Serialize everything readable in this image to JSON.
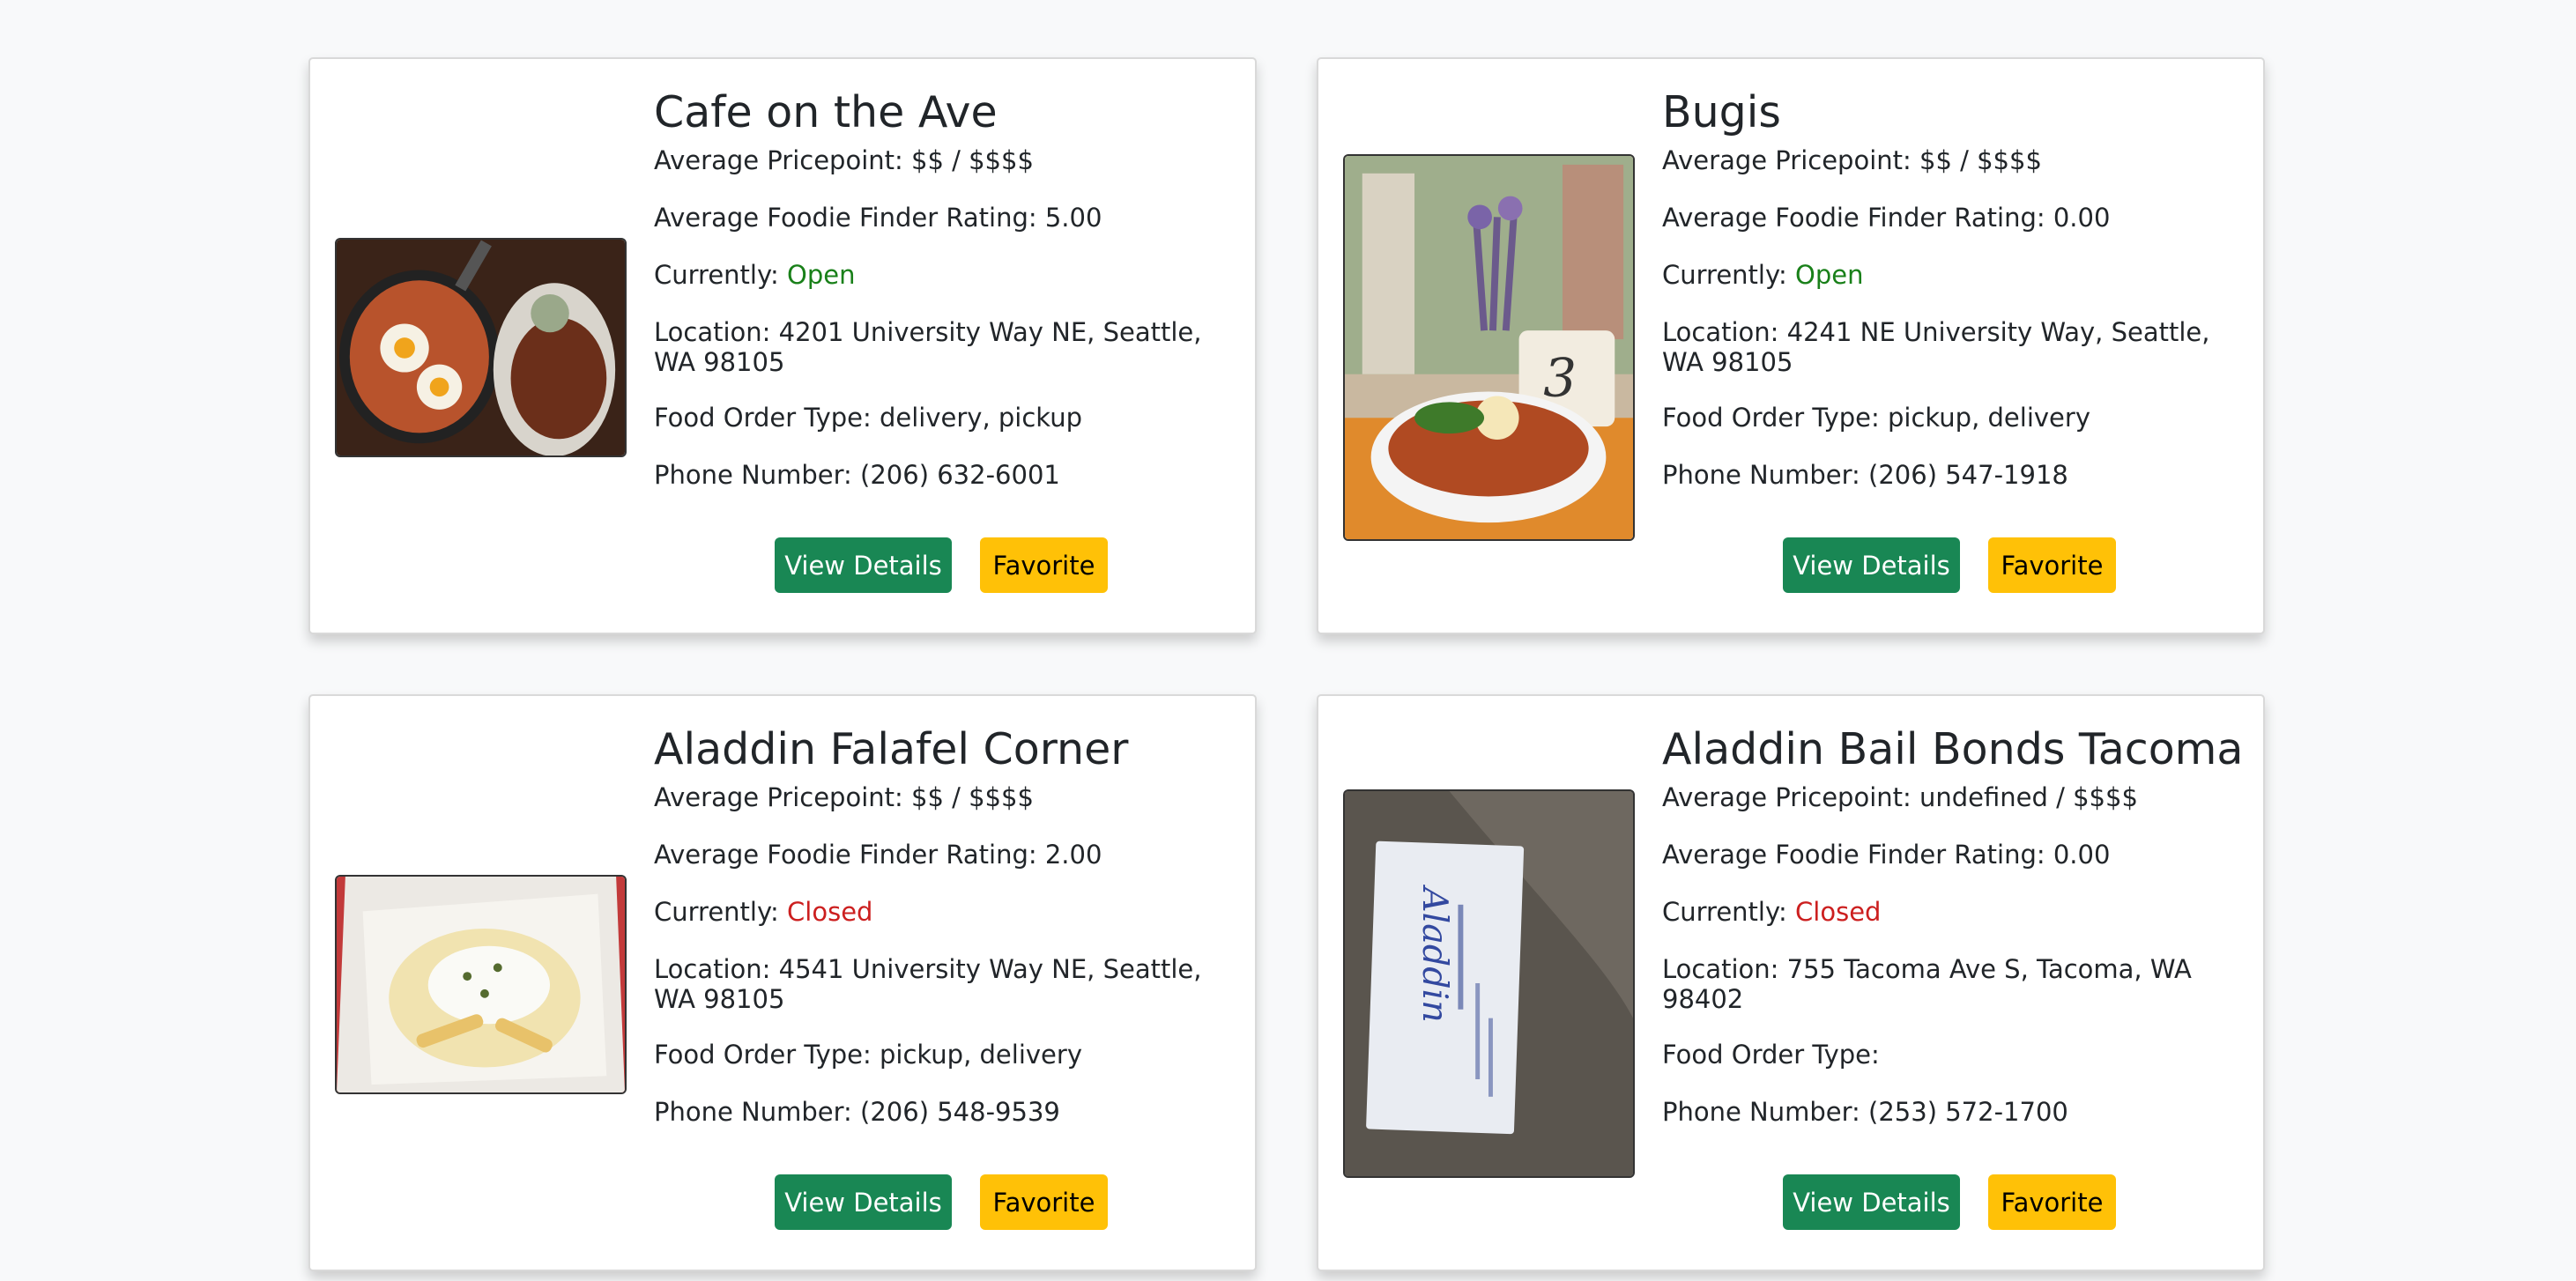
{
  "colors": {
    "page_bg": "#f8f9fa",
    "open": "#198019",
    "closed": "#cc1f1f",
    "details_button": "#198754",
    "favorite_button": "#ffc107"
  },
  "restaurants": [
    {
      "name": "Cafe on the Ave",
      "price": "Average Pricepoint: $$ / $$$$",
      "rating": "Average Foodie Finder Rating: 5.00",
      "status_label": "Currently: ",
      "status": "Open",
      "location": "Location: 4201 University Way NE, Seattle, WA 98105",
      "order_type": "Food Order Type: delivery, pickup",
      "phone": "Phone Number: (206) 632-6001",
      "details_label": "View Details",
      "favorite_label": "Favorite"
    },
    {
      "name": "Bugis",
      "price": "Average Pricepoint: $$ / $$$$",
      "rating": "Average Foodie Finder Rating: 0.00",
      "status_label": "Currently: ",
      "status": "Open",
      "location": "Location: 4241 NE University Way, Seattle, WA 98105",
      "order_type": "Food Order Type: pickup, delivery",
      "phone": "Phone Number: (206) 547-1918",
      "details_label": "View Details",
      "favorite_label": "Favorite"
    },
    {
      "name": "Aladdin Falafel Corner",
      "price": "Average Pricepoint: $$ / $$$$",
      "rating": "Average Foodie Finder Rating: 2.00",
      "status_label": "Currently: ",
      "status": "Closed",
      "location": "Location: 4541 University Way NE, Seattle, WA 98105",
      "order_type": "Food Order Type: pickup, delivery",
      "phone": "Phone Number: (206) 548-9539",
      "details_label": "View Details",
      "favorite_label": "Favorite"
    },
    {
      "name": "Aladdin Bail Bonds Tacoma",
      "price": "Average Pricepoint: undefined / $$$$",
      "rating": "Average Foodie Finder Rating: 0.00",
      "status_label": "Currently: ",
      "status": "Closed",
      "location": "Location: 755 Tacoma Ave S, Tacoma, WA 98402",
      "order_type": "Food Order Type:",
      "phone": "Phone Number: (253) 572-1700",
      "details_label": "View Details",
      "favorite_label": "Favorite"
    }
  ]
}
